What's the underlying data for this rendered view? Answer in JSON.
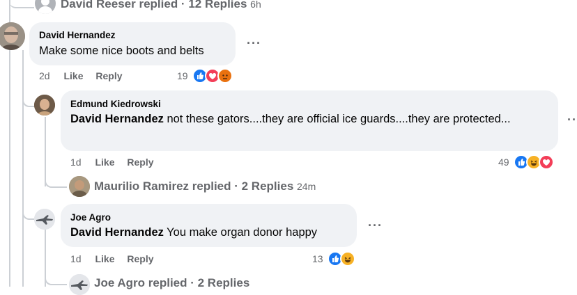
{
  "top_reply_row": {
    "name": "David Reeser",
    "label": "replied · 12 Replies",
    "time": "6h"
  },
  "comment1": {
    "author": "David Hernandez",
    "text": "Make some nice boots and belts",
    "time": "2d",
    "like": "Like",
    "reply": "Reply",
    "reaction_count": "19",
    "reactions": [
      "like-icon",
      "love-icon",
      "angry-icon"
    ]
  },
  "comment2": {
    "author": "Edmund Kiedrowski",
    "mention": "David Hernandez",
    "text": " not these gators....they are official ice guards....they are protected...",
    "time": "1d",
    "like": "Like",
    "reply": "Reply",
    "reaction_count": "49",
    "reactions": [
      "like-icon",
      "haha-icon",
      "love-icon"
    ]
  },
  "nested_reply_row": {
    "name": "Maurilio Ramirez",
    "label": "replied · 2 Replies",
    "time": "24m"
  },
  "comment3": {
    "author": "Joe Agro",
    "mention": "David Hernandez",
    "text": " You make organ donor happy",
    "time": "1d",
    "like": "Like",
    "reply": "Reply",
    "reaction_count": "13",
    "reactions": [
      "like-icon",
      "haha-icon"
    ]
  },
  "bottom_reply_row": {
    "name": "Joe Agro",
    "label": "replied · 2 Replies"
  },
  "dots": "···",
  "colors": {
    "bubble": "#f0f2f5",
    "meta": "#65676b",
    "like_blue": "#1877f2",
    "love_red": "#f33e58",
    "haha_yellow": "#f7b125"
  }
}
